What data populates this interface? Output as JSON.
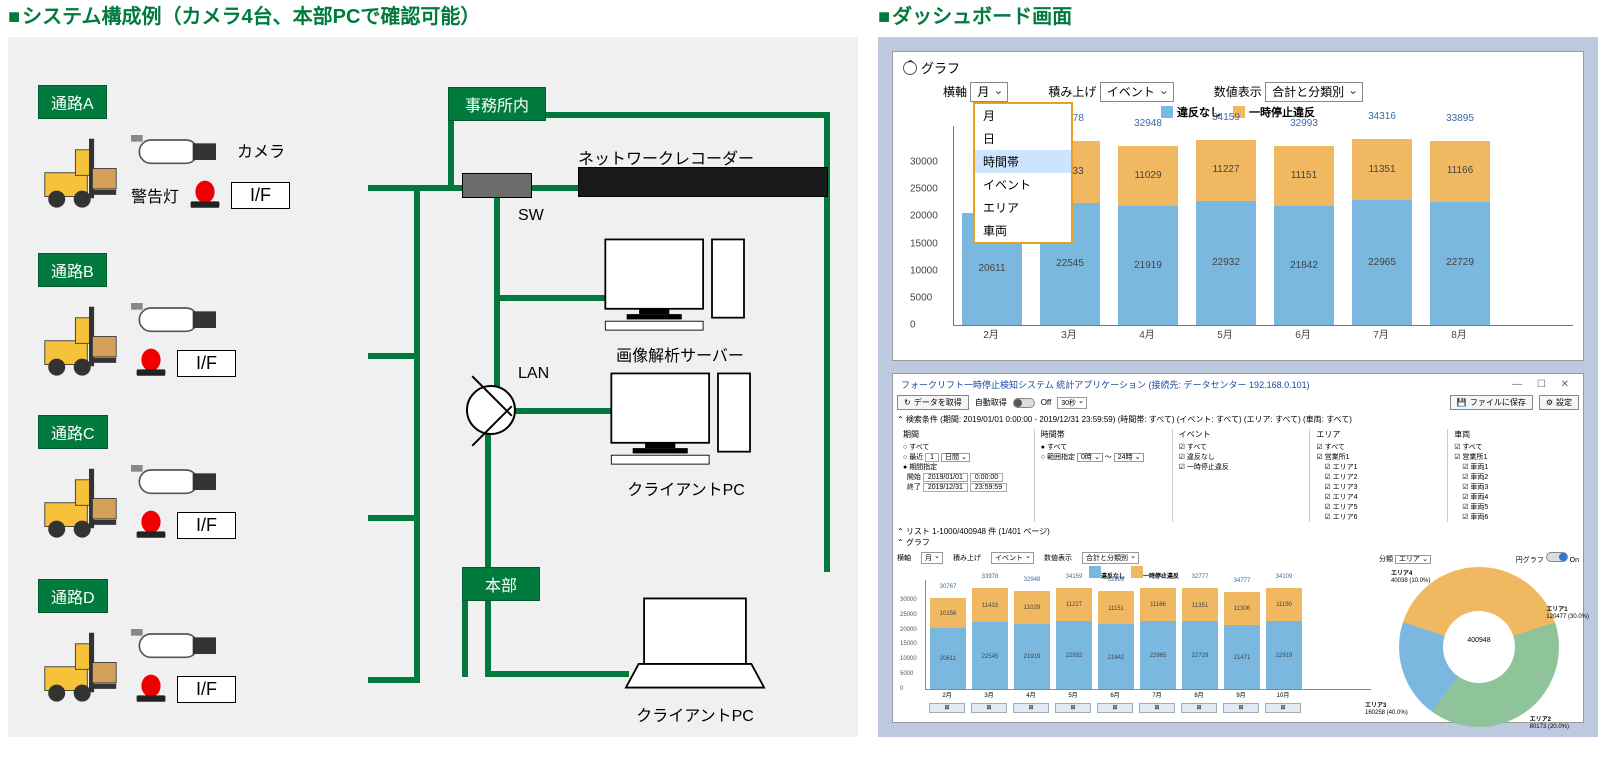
{
  "left": {
    "title": "システム構成例（カメラ4台、本部PCで確認可能）",
    "lanes": [
      {
        "label": "通路A",
        "if": "I/F"
      },
      {
        "label": "通路B",
        "if": "I/F"
      },
      {
        "label": "通路C",
        "if": "I/F"
      },
      {
        "label": "通路D",
        "if": "I/F"
      }
    ],
    "camera_label": "カメラ",
    "alarm_label": "警告灯",
    "office_label": "事務所内",
    "nvr_label": "ネットワークレコーダー",
    "sw_label": "SW",
    "lan_label": "LAN",
    "server_label": "画像解析サーバー",
    "client_label": "クライアントPC",
    "hq_label": "本部",
    "laptop_label": "クライアントPC"
  },
  "right": {
    "title": "ダッシュボード画面",
    "chart": {
      "section": "グラフ",
      "axis_label": "横軸",
      "axis_value": "月",
      "axis_options": [
        "月",
        "日",
        "時間帯",
        "イベント",
        "エリア",
        "車両"
      ],
      "stack_label": "積み上げ",
      "stack_value": "イベント",
      "num_label": "数値表示",
      "num_value": "合計と分類別",
      "legend": {
        "a": "違反なし",
        "b": "一時停止違反"
      }
    },
    "app": {
      "titlebar": "フォークリフト一時停止検知システム 統計アプリケーション (接続先: データセンター 192.168.0.101)",
      "btn_fetch": "データを取得",
      "auto_fetch": "自動取得",
      "auto_off": "Off",
      "interval": "30秒",
      "btn_save": "ファイルに保存",
      "btn_settings": "設定",
      "cond": "検索条件 (期間: 2019/01/01 0:00:00 - 2019/12/31 23:59:59) (時間帯: すべて) (イベント: すべて) (エリア: すべて) (車両: すべて)",
      "filters": {
        "period": {
          "hdr": "期間",
          "all": "すべて",
          "recent": "最近",
          "recent_n": "1",
          "recent_unit": "日間",
          "range": "期間指定",
          "start_lbl": "開始",
          "start_d": "2019/01/01",
          "start_t": "0:00:00",
          "end_lbl": "終了",
          "end_d": "2019/12/31",
          "end_t": "23:59:59"
        },
        "timeslot": {
          "hdr": "時間帯",
          "all": "すべて",
          "range": "範囲指定",
          "from": "0時",
          "to": "24時"
        },
        "event": {
          "hdr": "イベント",
          "all": "すべて",
          "items": [
            "違反なし",
            "一時停止違反"
          ]
        },
        "area": {
          "hdr": "エリア",
          "all": "すべて",
          "groups": [
            "営業所1"
          ],
          "items": [
            "エリア1",
            "エリア2",
            "エリア3",
            "エリア4",
            "エリア5",
            "エリア6"
          ]
        },
        "vehicle": {
          "hdr": "車両",
          "all": "すべて",
          "groups": [
            "営業所1"
          ],
          "items": [
            "車両1",
            "車両2",
            "車両3",
            "車両4",
            "車両5",
            "車両6"
          ]
        }
      },
      "list_status": "リスト 1-1000/400948 件 (1/401 ページ)",
      "graph_lbl": "グラフ",
      "mini": {
        "axis_lbl": "横軸",
        "axis_v": "月",
        "stack_lbl": "積み上げ",
        "stack_v": "イベント",
        "num_lbl": "数値表示",
        "num_v": "合計と分類別",
        "cat_lbl": "分類",
        "cat_v": "エリア",
        "donut_lbl": "円グラフ",
        "on": "On"
      },
      "donut": {
        "center": "400948",
        "slices": [
          {
            "name": "エリア1",
            "text": "120477 (30.0%)"
          },
          {
            "name": "エリア2",
            "text": "80173 (20.0%)"
          },
          {
            "name": "エリア3",
            "text": "160258 (40.0%)"
          },
          {
            "name": "エリア4",
            "text": "40038 (10.0%)"
          }
        ]
      }
    }
  },
  "chart_data": {
    "type": "bar",
    "stacked": true,
    "title": "グラフ",
    "ylim": [
      0,
      35000
    ],
    "yticks": [
      0,
      5000,
      10000,
      15000,
      20000,
      25000,
      30000
    ],
    "categories": [
      "2月",
      "3月",
      "4月",
      "5月",
      "6月",
      "7月",
      "8月"
    ],
    "series": [
      {
        "name": "違反なし",
        "color": "#7bb8e0",
        "values": [
          20611,
          22545,
          21919,
          22932,
          21842,
          22965,
          22729
        ]
      },
      {
        "name": "一時停止違反",
        "color": "#f0b860",
        "values": [
          null,
          11433,
          11029,
          11227,
          11151,
          11351,
          11166
        ]
      }
    ],
    "totals": [
      null,
      33978,
      32948,
      34159,
      32993,
      34316,
      33895
    ]
  },
  "mini_chart_data": {
    "type": "bar",
    "stacked": true,
    "ylim": [
      0,
      35000
    ],
    "yticks": [
      0,
      5000,
      10000,
      15000,
      20000,
      25000,
      30000
    ],
    "categories": [
      "2月",
      "3月",
      "4月",
      "5月",
      "6月",
      "7月",
      "8月",
      "9月",
      "10月"
    ],
    "series": [
      {
        "name": "違反なし",
        "color": "#7bb8e0",
        "values": [
          20611,
          22545,
          21919,
          22932,
          21842,
          22965,
          22729,
          21471,
          22919
        ]
      },
      {
        "name": "一時停止違反",
        "color": "#f0b860",
        "values": [
          10156,
          11433,
          11029,
          11227,
          11151,
          11166,
          11351,
          11306,
          11190
        ]
      }
    ],
    "totals": [
      30767,
      33978,
      32948,
      34159,
      32993,
      33845,
      32777,
      34777,
      34109
    ],
    "scrub_row": [
      "⊞",
      "⊞",
      "⊞",
      "⊞",
      "⊞",
      "⊞",
      "⊞",
      "⊞",
      "⊞"
    ]
  },
  "donut_data": {
    "type": "pie",
    "total": 400948,
    "slices": [
      {
        "name": "エリア1",
        "value": 120477,
        "pct": 30.0,
        "color": "#7bb8e0"
      },
      {
        "name": "エリア2",
        "value": 80173,
        "pct": 20.0,
        "color": "#f0b860"
      },
      {
        "name": "エリア3",
        "value": 160258,
        "pct": 40.0,
        "color": "#8fc49a"
      },
      {
        "name": "エリア4",
        "value": 40038,
        "pct": 10.0,
        "color": "#f0b860"
      }
    ]
  }
}
